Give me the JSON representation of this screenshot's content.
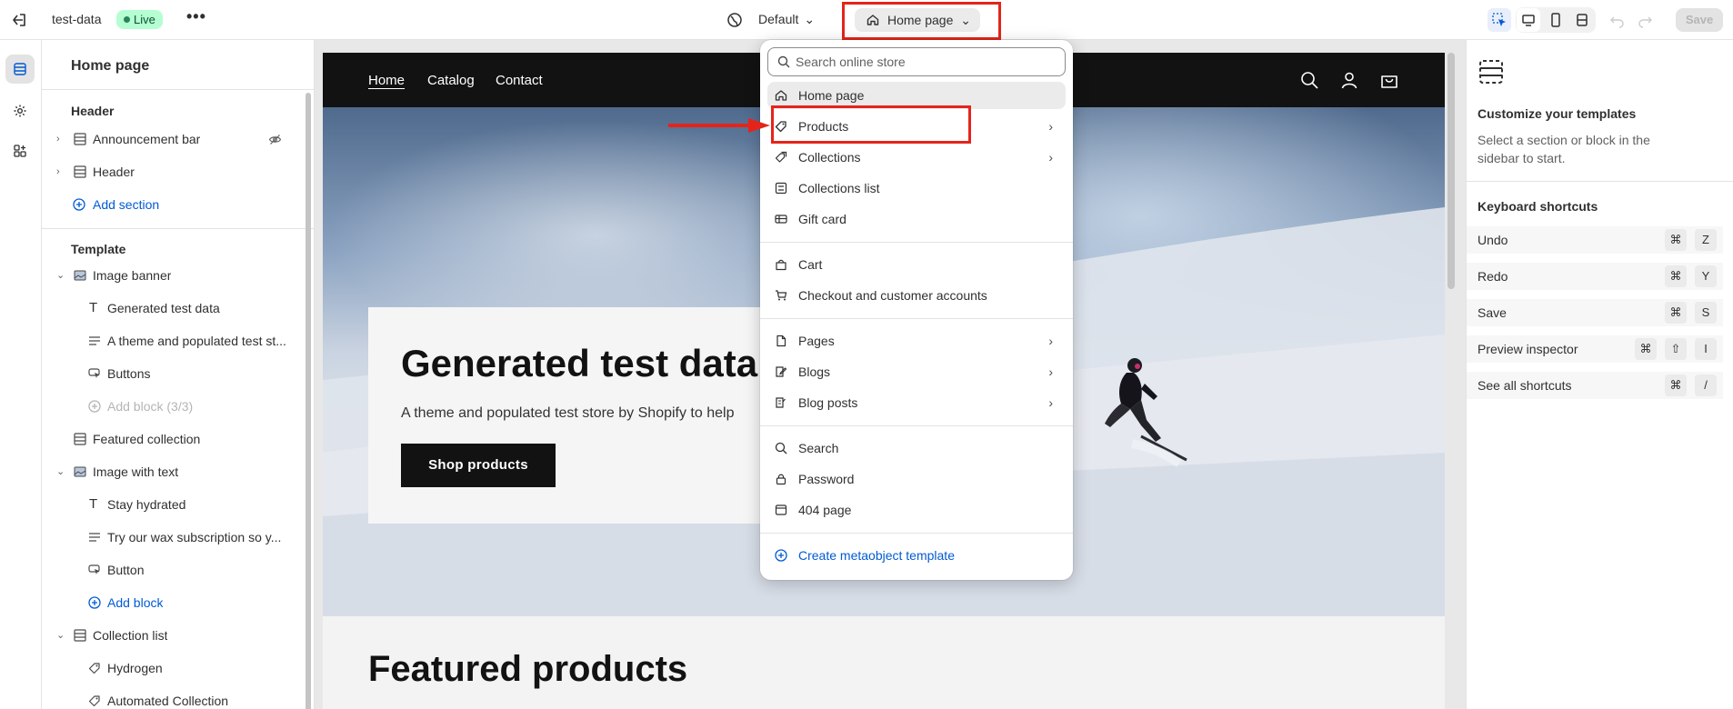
{
  "topbar": {
    "store_name": "test-data",
    "status_badge": "Live",
    "more_label": "•••",
    "theme_label": "Default",
    "page_select_label": "Home page",
    "save_label": "Save"
  },
  "sidebar": {
    "title": "Home page",
    "header_group": {
      "heading": "Header",
      "items": [
        {
          "label": "Announcement bar"
        },
        {
          "label": "Header"
        }
      ],
      "add_section": "Add section"
    },
    "template_group": {
      "heading": "Template",
      "items": [
        {
          "label": "Image banner"
        },
        {
          "label": "Generated test data"
        },
        {
          "label": "A theme and populated test st..."
        },
        {
          "label": "Buttons"
        },
        {
          "label": "Add block (3/3)"
        },
        {
          "label": "Featured collection"
        },
        {
          "label": "Image with text"
        },
        {
          "label": "Stay hydrated"
        },
        {
          "label": "Try our wax subscription so y..."
        },
        {
          "label": "Button"
        },
        {
          "label": "Add block"
        },
        {
          "label": "Collection list"
        },
        {
          "label": "Hydrogen"
        },
        {
          "label": "Automated Collection"
        }
      ]
    }
  },
  "preview": {
    "nav": [
      "Home",
      "Catalog",
      "Contact"
    ],
    "hero_title": "Generated test data",
    "hero_subtitle": "A theme and populated test store by Shopify to help",
    "hero_button": "Shop products",
    "featured_title": "Featured products"
  },
  "dropdown": {
    "search_placeholder": "Search online store",
    "groups": [
      [
        {
          "label": "Home page",
          "icon": "home-icon",
          "selected": true
        },
        {
          "label": "Products",
          "icon": "tag-icon",
          "submenu": true
        },
        {
          "label": "Collections",
          "icon": "tags-icon",
          "submenu": true
        },
        {
          "label": "Collections list",
          "icon": "list-icon"
        },
        {
          "label": "Gift card",
          "icon": "gift-card-icon"
        }
      ],
      [
        {
          "label": "Cart",
          "icon": "bag-icon"
        },
        {
          "label": "Checkout and customer accounts",
          "icon": "cart-icon"
        }
      ],
      [
        {
          "label": "Pages",
          "icon": "page-icon",
          "submenu": true
        },
        {
          "label": "Blogs",
          "icon": "blog-icon",
          "submenu": true
        },
        {
          "label": "Blog posts",
          "icon": "blog-post-icon",
          "submenu": true
        }
      ],
      [
        {
          "label": "Search",
          "icon": "search-icon"
        },
        {
          "label": "Password",
          "icon": "lock-icon"
        },
        {
          "label": "404 page",
          "icon": "error-page-icon"
        }
      ]
    ],
    "create_link": "Create metaobject template"
  },
  "rpanel": {
    "title": "Customize your templates",
    "description": "Select a section or block in the sidebar to start.",
    "shortcuts_title": "Keyboard shortcuts",
    "shortcuts": [
      {
        "label": "Undo",
        "keys": [
          "⌘",
          "Z"
        ]
      },
      {
        "label": "Redo",
        "keys": [
          "⌘",
          "Y"
        ]
      },
      {
        "label": "Save",
        "keys": [
          "⌘",
          "S"
        ]
      },
      {
        "label": "Preview inspector",
        "keys": [
          "⌘",
          "⇧",
          "I"
        ]
      },
      {
        "label": "See all shortcuts",
        "keys": [
          "⌘",
          "/"
        ]
      }
    ]
  },
  "colors": {
    "accent_link": "#005bd3",
    "live_badge_bg": "#b4fed2",
    "annotation_red": "#e4241b",
    "store_nav_bg": "#121212"
  }
}
